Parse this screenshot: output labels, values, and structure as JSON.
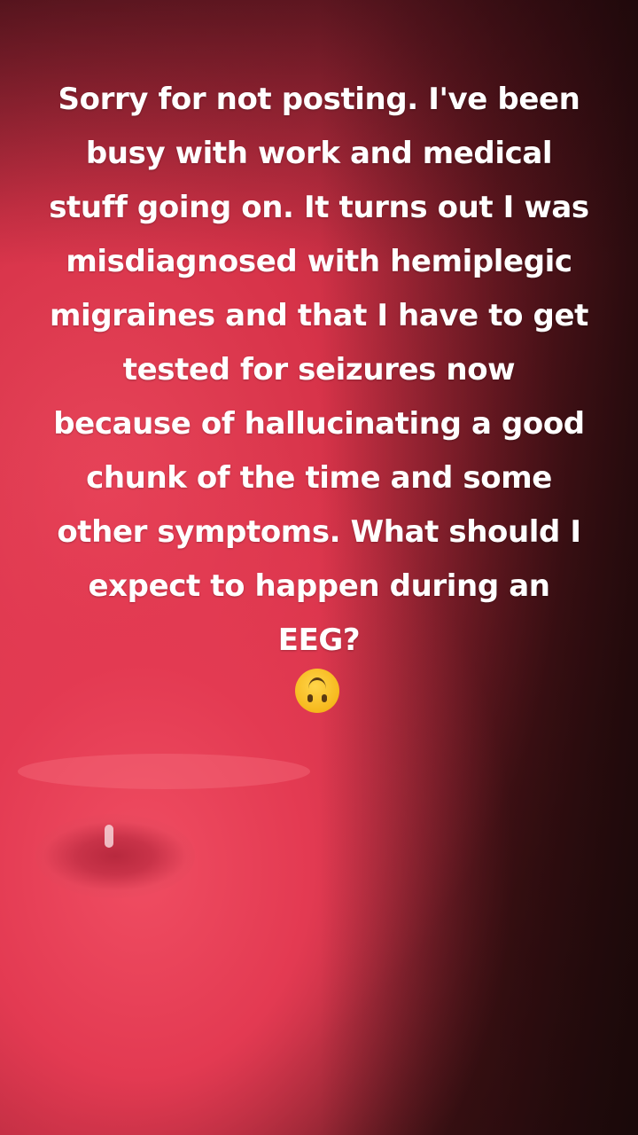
{
  "caption": {
    "lines": [
      "Sorry for not posting. I've been",
      "busy with work and medical",
      "stuff going on. It turns out I was",
      "misdiagnosed with hemiplegic",
      "migraines and that I have to get",
      "tested for seizures now",
      "because of hallucinating a good",
      "chunk of the time and some",
      "other symptoms. What should I",
      "expect to happen during an",
      "EEG?"
    ],
    "emoji": "upside-down-face-icon"
  },
  "colors": {
    "text": "#ffffff",
    "background_primary": "#e33a52",
    "background_dark": "#1c0c0d",
    "emoji_face": "#f6b81c"
  }
}
